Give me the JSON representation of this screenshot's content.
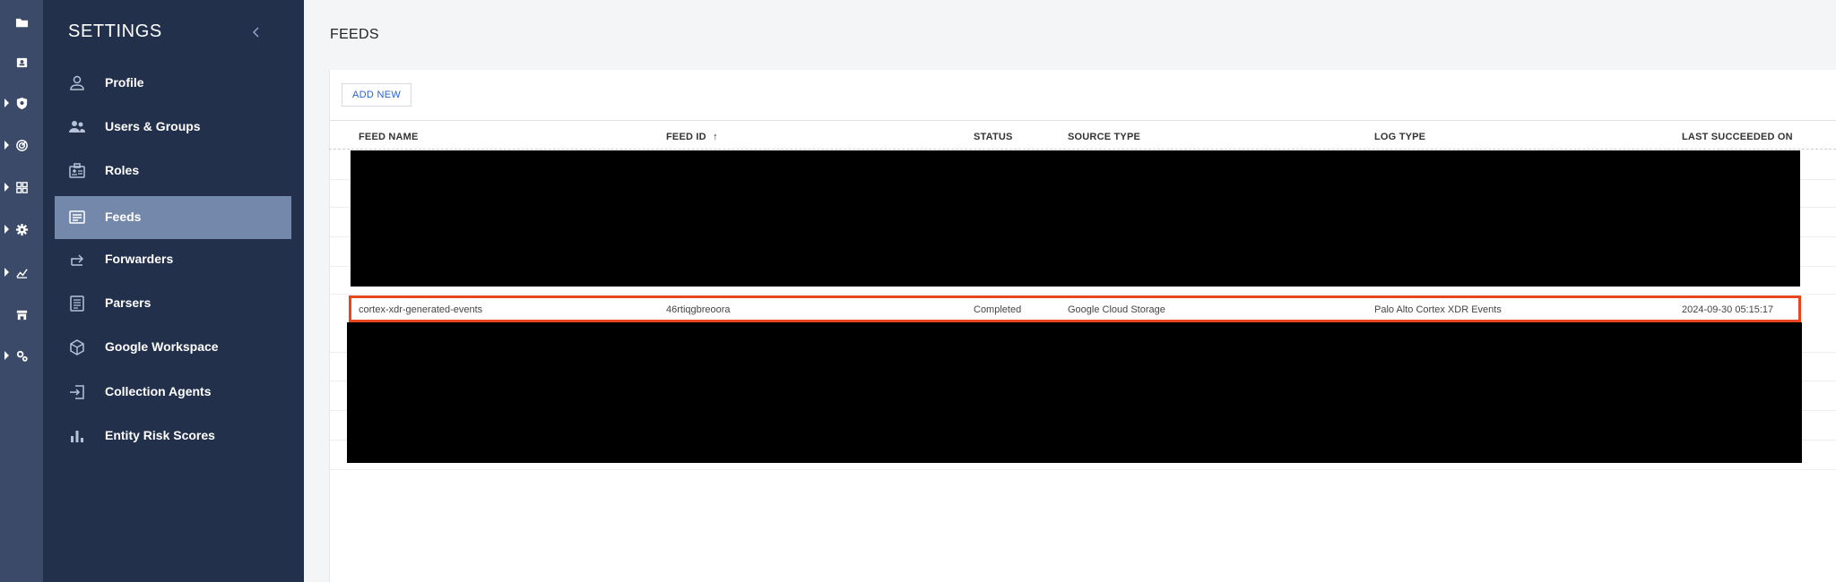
{
  "rail": {
    "items": [
      {
        "icon": "folder-icon",
        "has_caret": false
      },
      {
        "icon": "badge-icon",
        "has_caret": false
      },
      {
        "icon": "shield-icon",
        "has_caret": true
      },
      {
        "icon": "radar-icon",
        "has_caret": true
      },
      {
        "icon": "grid-icon",
        "has_caret": true
      },
      {
        "icon": "gear-icon",
        "has_caret": true
      },
      {
        "icon": "chart-icon",
        "has_caret": true
      },
      {
        "icon": "store-icon",
        "has_caret": false
      },
      {
        "icon": "gears-icon",
        "has_caret": true
      }
    ]
  },
  "sidebar": {
    "title": "SETTINGS",
    "items": [
      {
        "label": "Profile",
        "icon": "person-icon"
      },
      {
        "label": "Users & Groups",
        "icon": "group-icon"
      },
      {
        "label": "Roles",
        "icon": "id-badge-icon"
      },
      {
        "label": "Feeds",
        "icon": "feed-icon",
        "active": true
      },
      {
        "label": "Forwarders",
        "icon": "forward-icon"
      },
      {
        "label": "Parsers",
        "icon": "document-icon"
      },
      {
        "label": "Google Workspace",
        "icon": "cube-icon"
      },
      {
        "label": "Collection Agents",
        "icon": "login-icon"
      },
      {
        "label": "Entity Risk Scores",
        "icon": "bar-chart-icon"
      }
    ]
  },
  "main": {
    "title": "FEEDS",
    "add_new_label": "ADD NEW"
  },
  "table": {
    "headers": {
      "feed_name": "FEED NAME",
      "feed_id": "FEED ID",
      "sort_indicator": "↑",
      "status": "STATUS",
      "source_type": "SOURCE TYPE",
      "log_type": "LOG TYPE",
      "last_succeeded": "LAST SUCCEEDED ON"
    },
    "highlighted_row": {
      "feed_name": "cortex-xdr-generated-events",
      "feed_id": "46rtiqgbreoora",
      "status": "Completed",
      "source_type": "Google Cloud Storage",
      "log_type": "Palo Alto Cortex XDR Events",
      "last_succeeded": "2024-09-30 05:15:17"
    }
  },
  "colors": {
    "rail_bg": "#3b4a69",
    "panel_bg": "#22304b",
    "active_item_bg": "#7388ab",
    "highlight_border": "#e8461e",
    "link_blue": "#2a63c9"
  }
}
